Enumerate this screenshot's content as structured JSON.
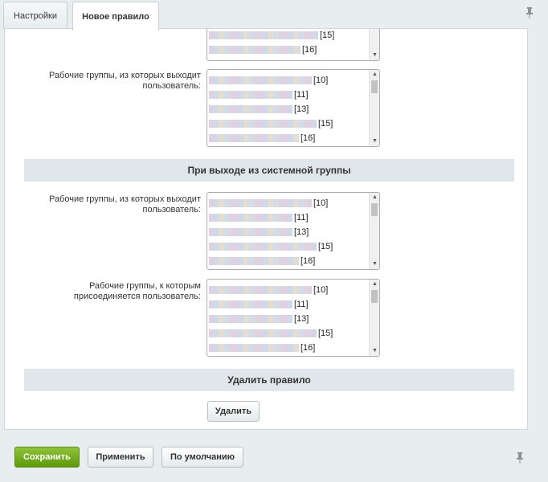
{
  "tabs": [
    {
      "label": "Настройки",
      "active": false
    },
    {
      "label": "Новое правило",
      "active": true
    }
  ],
  "fields": {
    "exit_groups_label_top": "Рабочие группы, из которых выходит пользователь:",
    "section_exit_system": "При выходе из системной группы",
    "exit_groups_label": "Рабочие группы, из которых выходит пользователь:",
    "join_groups_label": "Рабочие группы, к которым присоединяется пользователь:",
    "section_delete": "Удалить правило"
  },
  "listbox_partial": {
    "options": [
      "[15]",
      "[16]"
    ]
  },
  "listbox_options": [
    "[10]",
    "[11]",
    "[13]",
    "[15]",
    "[16]"
  ],
  "buttons": {
    "delete": "Удалить",
    "save": "Сохранить",
    "apply": "Применить",
    "default": "По умолчанию"
  },
  "colors": {
    "save_button": "#6aa51b",
    "section_bg": "#e0e7ea",
    "page_bg": "#e8eef0"
  },
  "icons": {
    "pin": "pin-icon",
    "scroll_up": "arrow-up-icon",
    "scroll_down": "arrow-down-icon"
  }
}
